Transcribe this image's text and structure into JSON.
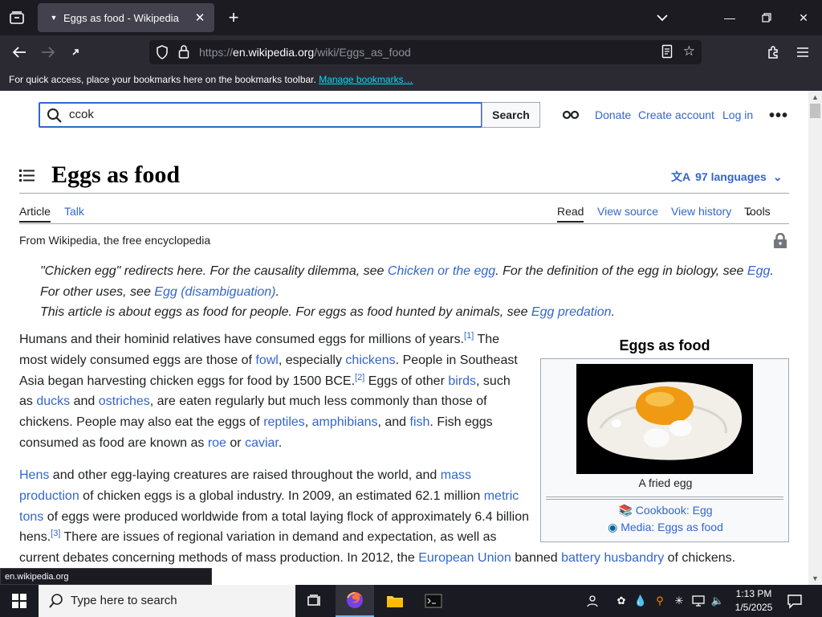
{
  "tab": {
    "title": "Eggs as food - Wikipedia"
  },
  "navbar": {
    "url_domain": "en.wikipedia.org",
    "url_prefix": "https://",
    "url_path": "/wiki/Eggs_as_food"
  },
  "bookmarks": {
    "text": "For quick access, place your bookmarks here on the bookmarks toolbar.",
    "link": "Manage bookmarks…"
  },
  "header": {
    "search_value": "ccok",
    "search_button": "Search",
    "donate": "Donate",
    "create_account": "Create account",
    "log_in": "Log in"
  },
  "article": {
    "title": "Eggs as food",
    "languages": "97 languages",
    "tabs": {
      "article": "Article",
      "talk": "Talk",
      "read": "Read",
      "view_source": "View source",
      "view_history": "View history",
      "tools": "Tools"
    },
    "from": "From Wikipedia, the free encyclopedia",
    "hatnotes": [
      {
        "pre": "\"Chicken egg\" redirects here. For the causality dilemma, see ",
        "link1": "Chicken or the egg",
        "mid": ". For the definition of the egg in biology, see ",
        "link2": "Egg",
        "post": "."
      },
      {
        "pre": "For other uses, see ",
        "link1": "Egg (disambiguation)",
        "post": "."
      },
      {
        "pre": "This article is about eggs as food for people. For eggs as food hunted by animals, see ",
        "link1": "Egg predation",
        "post": "."
      }
    ],
    "para1": {
      "l1a": "Humans and their hominid relatives have consumed eggs for millions of years.",
      "ref1": "[1]",
      "l1b": " The",
      "l2a": "most widely consumed eggs are those of ",
      "fowl": "fowl",
      "l2b": ", especially ",
      "chickens": "chickens",
      "l2c": ". People in Southeast",
      "l3a": "Asia began harvesting chicken eggs for food by 1500 BCE.",
      "ref2": "[2]",
      "l3b": " Eggs of other ",
      "birds": "birds",
      "l3c": ", such",
      "l4a": "as ",
      "ducks": "ducks",
      "l4b": " and ",
      "ostriches": "ostriches",
      "l4c": ", are eaten regularly but much less commonly than those of",
      "l5a": "chickens. People may also eat the eggs of ",
      "reptiles": "reptiles",
      "l5b": ", ",
      "amphibians": "amphibians",
      "l5c": ", and ",
      "fish": "fish",
      "l5d": ". Fish eggs",
      "l6a": "consumed as food are known as ",
      "roe": "roe",
      "l6b": " or ",
      "caviar": "caviar",
      "l6c": "."
    },
    "para2": {
      "hens": "Hens",
      "l1a": " and other egg-laying creatures are raised throughout the world, and ",
      "mass": "mass",
      "production": "production",
      "l2a": " of chicken eggs is a global industry. In 2009, an estimated 62.1 million ",
      "metric": "metric",
      "tons": "tons",
      "l3a": " of eggs were produced worldwide from a total laying flock of approximately 6.4 billion",
      "l4a": "hens.",
      "ref3": "[3]",
      "l4b": " There are issues of regional variation in demand and expectation, as well as",
      "l5a": "current debates concerning methods of mass production. In 2012, the ",
      "eu": "European Union",
      "l5b": " banned ",
      "battery": "battery husbandry",
      "l5c": " of chickens."
    },
    "infobox": {
      "title": "Eggs as food",
      "caption": "A fried egg",
      "cookbook": "Cookbook: Egg",
      "media": "Media: Eggs as food"
    }
  },
  "status": "en.wikipedia.org",
  "taskbar": {
    "search_placeholder": "Type here to search",
    "time": "1:13 PM",
    "date": "1/5/2025"
  }
}
